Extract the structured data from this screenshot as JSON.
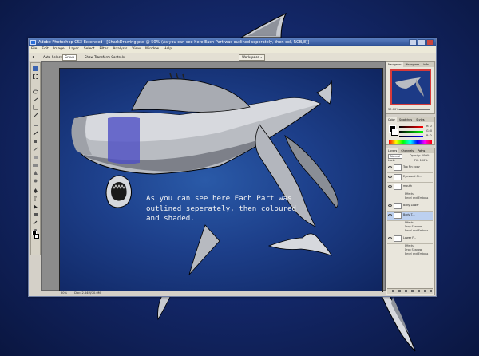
{
  "app": {
    "title": "Adobe Photoshop CS3 Extended - [SharkDrawing.psd @ 50% (As you can see here Each Part was outlined seperately, then col, RGB/8)]",
    "window_buttons": [
      "minimize",
      "maximize",
      "close"
    ]
  },
  "menu": [
    "File",
    "Edit",
    "Image",
    "Layer",
    "Select",
    "Filter",
    "Analysis",
    "View",
    "Window",
    "Help"
  ],
  "options_bar": {
    "auto_select": "Auto-Select:",
    "auto_select_value": "Group",
    "show_transform": "Show Transform Controls",
    "workspace": "Workspace ▾"
  },
  "canvas": {
    "caption_lines": [
      "As you can see here Each Part was",
      "outlined seperately, then coloured",
      "and shaded."
    ]
  },
  "statusbar": {
    "zoom": "50%",
    "doc": "Doc: 2.64M/70.0M"
  },
  "panels": {
    "navigator_tabs": [
      "Navigator",
      "Histogram",
      "Info"
    ],
    "navigator_zoom": "50.00%",
    "color_tabs": [
      "Color",
      "Swatches",
      "Styles"
    ],
    "color_values": [
      "R: 0",
      "G: 0",
      "B: 0"
    ],
    "layers_tabs": [
      "Layers",
      "Channels",
      "Paths"
    ],
    "blend_mode": "Normal",
    "opacity": "Opacity: 100%",
    "lock": "Lock:",
    "fill": "Fill: 100%",
    "layers": [
      {
        "name": "Top Fin copy",
        "fx": false
      },
      {
        "name": "Eyes and Gi...",
        "fx": false
      },
      {
        "name": "mouth",
        "fx": true,
        "effects": [
          "Effects",
          "Bevel and Emboss"
        ]
      },
      {
        "name": "Body Lower",
        "fx": false
      },
      {
        "name": "Body T...",
        "fx": true,
        "effects": [
          "Effects",
          "Drop Shadow",
          "Bevel and Emboss"
        ]
      },
      {
        "name": "Lower F...",
        "fx": true,
        "effects": [
          "Effects",
          "Drop Shadow",
          "Bevel and Emboss"
        ]
      }
    ]
  },
  "colors": {
    "desktop": "#14296c",
    "canvas": "#1d3f8a",
    "shark_body": "#b8bac0",
    "accent_purple": "#4d4dc4",
    "nav_border": "#d63a3a"
  }
}
